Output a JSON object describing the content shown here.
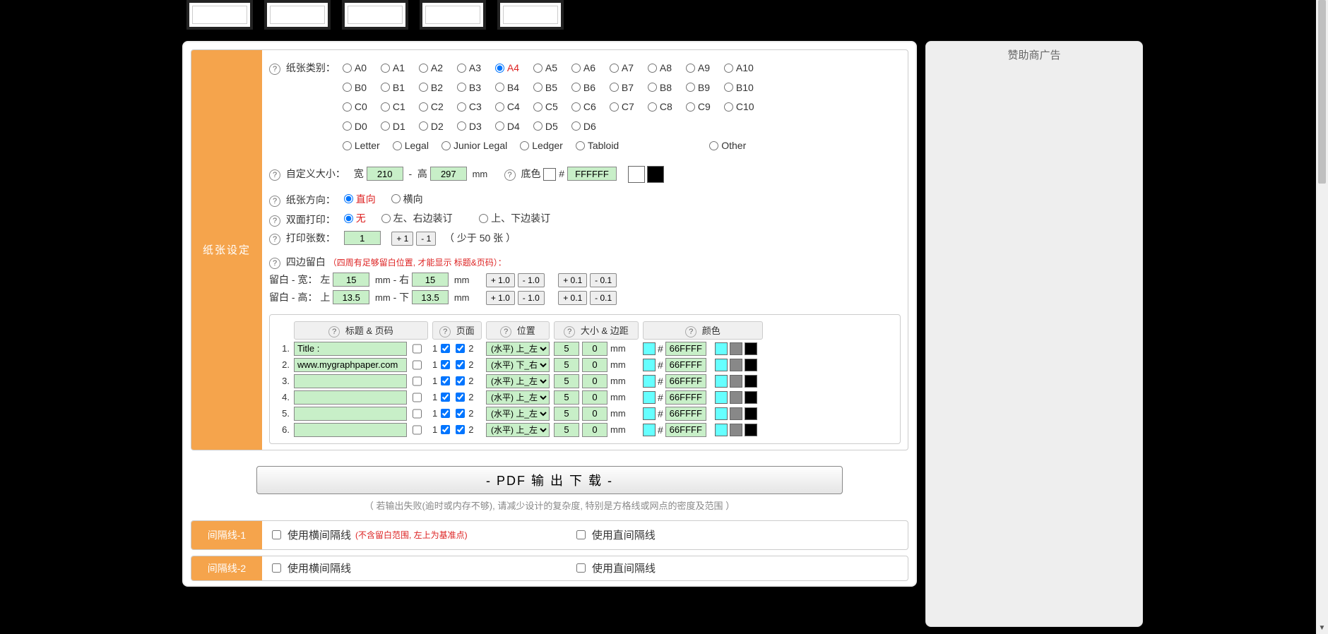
{
  "ad_title": "赞助商广告",
  "section_paper_label": "纸张设定",
  "paper_type_label": "纸张类别：",
  "paper_types": {
    "A": [
      "A0",
      "A1",
      "A2",
      "A3",
      "A4",
      "A5",
      "A6",
      "A7",
      "A8",
      "A9",
      "A10"
    ],
    "B": [
      "B0",
      "B1",
      "B2",
      "B3",
      "B4",
      "B5",
      "B6",
      "B7",
      "B8",
      "B9",
      "B10"
    ],
    "C": [
      "C0",
      "C1",
      "C2",
      "C3",
      "C4",
      "C5",
      "C6",
      "C7",
      "C8",
      "C9",
      "C10"
    ],
    "D": [
      "D0",
      "D1",
      "D2",
      "D3",
      "D4",
      "D5",
      "D6"
    ],
    "named": [
      "Letter",
      "Legal",
      "Junior Legal",
      "Ledger",
      "Tabloid"
    ],
    "other": "Other"
  },
  "paper_type_selected": "A4",
  "custom": {
    "label": "自定义大小：",
    "w_label": "宽",
    "w": "210",
    "h_label": "高",
    "h": "297",
    "unit": "mm",
    "bg_label": "底色",
    "bg_hex": "FFFFFF",
    "hash": "#",
    "swatch_white": "#ffffff",
    "swatch_black": "#000000"
  },
  "orient": {
    "label": "纸张方向：",
    "opt1": "直向",
    "opt2": "横向",
    "selected": "直向"
  },
  "duplex": {
    "label": "双面打印：",
    "opt1": "无",
    "opt2": "左、右边装订",
    "opt3": "上、下边装订",
    "selected": "无"
  },
  "copies": {
    "label": "打印张数：",
    "value": "1",
    "plus": "+ 1",
    "minus": "- 1",
    "note": "（ 少于 50 张 ）"
  },
  "margins": {
    "label": "四边留白",
    "note": "（四周有足够留白位置, 才能显示 标题&页码）：",
    "row_w_label": "留白 - 宽：",
    "row_h_label": "留白 - 高：",
    "left_l": "左",
    "right_l": "右",
    "top_l": "上",
    "bottom_l": "下",
    "left": "15",
    "right": "15",
    "top": "13.5",
    "bottom": "13.5",
    "unit": "mm",
    "p10": "+ 1.0",
    "m10": "- 1.0",
    "p01": "+ 0.1",
    "m01": "- 0.1"
  },
  "tt": {
    "h_title": "标题 & 页码",
    "h_page": "页面",
    "h_pos": "位置",
    "h_size": "大小 & 边距",
    "h_color": "颜色",
    "rows": [
      {
        "n": "1.",
        "text": "Title :",
        "pos": "(水平) 上_左",
        "s": "5",
        "m": "0",
        "hex": "66FFFF"
      },
      {
        "n": "2.",
        "text": "www.mygraphpaper.com",
        "pos": "(水平) 下_右",
        "s": "5",
        "m": "0",
        "hex": "66FFFF"
      },
      {
        "n": "3.",
        "text": "",
        "pos": "(水平) 上_左",
        "s": "5",
        "m": "0",
        "hex": "66FFFF"
      },
      {
        "n": "4.",
        "text": "",
        "pos": "(水平) 上_左",
        "s": "5",
        "m": "0",
        "hex": "66FFFF"
      },
      {
        "n": "5.",
        "text": "",
        "pos": "(水平) 上_左",
        "s": "5",
        "m": "0",
        "hex": "66FFFF"
      },
      {
        "n": "6.",
        "text": "",
        "pos": "(水平) 上_左",
        "s": "5",
        "m": "0",
        "hex": "66FFFF"
      }
    ],
    "page1": "1",
    "page2": "2",
    "mm": "mm",
    "hash": "#",
    "color_cyan": "#66FFFF",
    "color_gray": "#888888",
    "color_black": "#000000"
  },
  "download": {
    "btn": "- PDF 输 出 下 载 -",
    "note": "（ 若输出失败(逾时或内存不够), 请减少设计的复杂度, 特别是方格线或网点的密度及范围 ）"
  },
  "sep": [
    {
      "label": "间隔线-1",
      "h": "使用横间隔线",
      "hnote": "(不含留白范围, 左上为基准点)",
      "v": "使用直间隔线"
    },
    {
      "label": "间隔线-2",
      "h": "使用横间隔线",
      "hnote": "",
      "v": "使用直间隔线"
    }
  ]
}
